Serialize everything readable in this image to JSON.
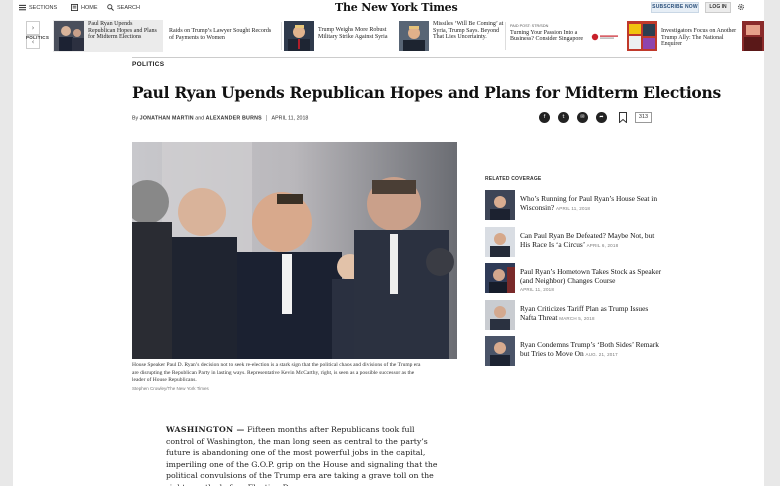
{
  "topbar": {
    "sections": "SECTIONS",
    "home": "HOME",
    "search": "SEARCH",
    "logo": "The New York Times",
    "subscribe": "SUBSCRIBE NOW",
    "login": "LOG IN"
  },
  "ribbon": {
    "section_tag": "POLITICS",
    "items": [
      {
        "title": "Paul Ryan Upends Republican Hopes and Plans for Midterm Elections"
      },
      {
        "title": "Raids on Trump’s Lawyer Sought Records of Payments to Women"
      },
      {
        "title": "Trump Weighs More Robust Military Strike Against Syria"
      },
      {
        "title": "Missiles ‘Will Be Coming’ at Syria, Trump Says. Beyond That Lies Uncertainty."
      },
      {
        "kicker": "PAID POST: STR/SDN",
        "title": "Turning Your Passion Into a Business? Consider Singapore"
      },
      {
        "title": "Investigators Focus on Another Trump Ally: The National Enquirer"
      }
    ]
  },
  "article": {
    "section": "POLITICS",
    "headline": "Paul Ryan Upends Republican Hopes and Plans for Midterm Elections",
    "by": "By",
    "author1": "JONATHAN MARTIN",
    "and": "and",
    "author2": "ALEXANDER BURNS",
    "date": "APRIL 11, 2018",
    "comment_count": "313",
    "caption": "House Speaker Paul D. Ryan’s decision not to seek re-election is a stark sign that the political chaos and divisions of the Trump era are disrupting the Republican Party in lasting ways. Representative Kevin McCarthy, right, is seen as a possible successor as the leader of House Republicans.",
    "credit": "Stephen Crowley/The New York Times",
    "dateline": "WASHINGTON —",
    "body": "Fifteen months after Republicans took full control of Washington, the man long seen as central to the party’s future is abandoning one of the most powerful jobs in the capital, imperiling one of the G.O.P. grip on the House and signaling that the political convulsions of the Trump era are taking a grave toll on the right months before Election Day."
  },
  "related": {
    "heading": "RELATED COVERAGE",
    "items": [
      {
        "title": "Who’s Running for Paul Ryan’s House Seat in Wisconsin?",
        "date": "APRIL 11, 2018"
      },
      {
        "title": "Can Paul Ryan Be Defeated? Maybe Not, but His Race Is ‘a Circus’",
        "date": "APRIL 6, 2018"
      },
      {
        "title": "Paul Ryan’s Hometown Takes Stock as Speaker (and Neighbor) Changes Course",
        "date": "APRIL 11, 2018"
      },
      {
        "title": "Ryan Criticizes Tariff Plan as Trump Issues Nafta Threat",
        "date": "MARCH 5, 2018"
      },
      {
        "title": "Ryan Condemns Trump’s ‘Both Sides’ Remark but Tries to Move On",
        "date": "AUG. 21, 2017"
      }
    ]
  }
}
